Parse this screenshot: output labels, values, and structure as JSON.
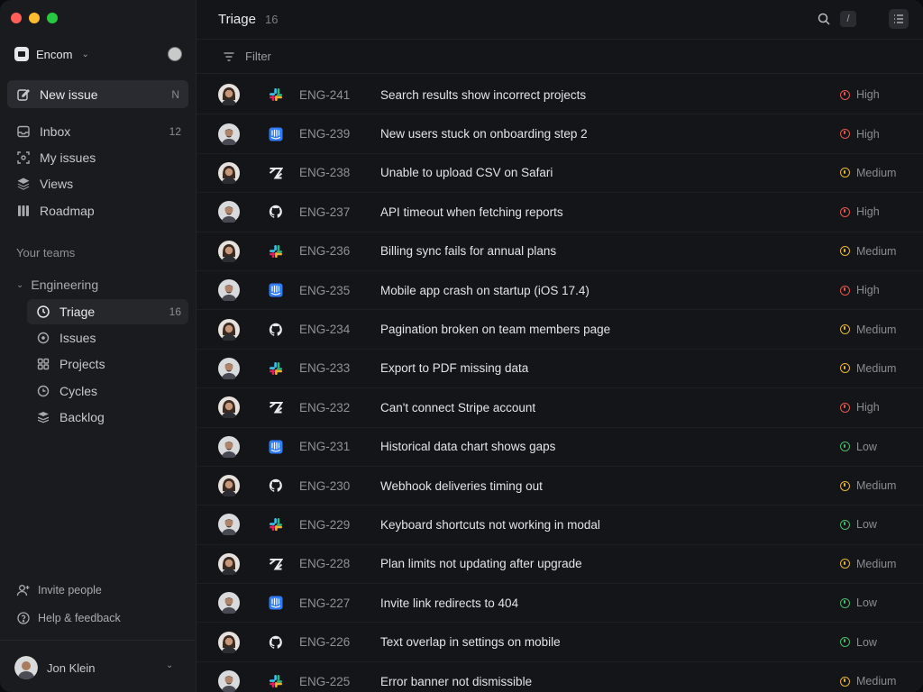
{
  "colors": {
    "red": "#ff5f57",
    "yellow": "#febc2e",
    "green": "#28c840",
    "high": "#e5574f",
    "medium": "#e4b43a",
    "low": "#4bb86a",
    "jira_blue": "#2f7cf6"
  },
  "workspace": {
    "name": "Encom"
  },
  "sidebar": {
    "new_issue": {
      "label": "New issue",
      "shortcut": "N"
    },
    "nav": [
      {
        "label": "Inbox",
        "icon": "inbox-icon",
        "count": "12"
      },
      {
        "label": "My issues",
        "icon": "target-icon",
        "count": ""
      },
      {
        "label": "Views",
        "icon": "layers-icon",
        "count": ""
      },
      {
        "label": "Roadmap",
        "icon": "roadmap-icon",
        "count": ""
      }
    ],
    "section": "Your teams",
    "team": {
      "name": "Engineering"
    },
    "team_items": [
      {
        "label": "Triage",
        "icon": "triage-icon",
        "count": "16"
      },
      {
        "label": "Issues",
        "icon": "circle-icon",
        "count": ""
      },
      {
        "label": "Projects",
        "icon": "grid-icon",
        "count": ""
      },
      {
        "label": "Cycles",
        "icon": "cycle-icon",
        "count": ""
      },
      {
        "label": "Backlog",
        "icon": "stack-icon",
        "count": ""
      }
    ],
    "invite": "Invite people",
    "help": "Help & feedback",
    "user": "Jon Klein"
  },
  "header": {
    "title": "Triage",
    "count": "16",
    "search_shortcut": "/"
  },
  "filter": {
    "label": "Filter"
  },
  "issues": [
    {
      "id": "ENG-241",
      "title": "Search results show incorrect projects",
      "source": "slack",
      "priority": "High",
      "avatar": "f"
    },
    {
      "id": "ENG-239",
      "title": "New users stuck on onboarding step 2",
      "source": "intercom",
      "priority": "High",
      "avatar": "m"
    },
    {
      "id": "ENG-238",
      "title": "Unable to upload CSV on Safari",
      "source": "zendesk",
      "priority": "Medium",
      "avatar": "f"
    },
    {
      "id": "ENG-237",
      "title": "API timeout when fetching reports",
      "source": "github",
      "priority": "High",
      "avatar": "m"
    },
    {
      "id": "ENG-236",
      "title": "Billing sync fails for annual plans",
      "source": "slack",
      "priority": "Medium",
      "avatar": "f"
    },
    {
      "id": "ENG-235",
      "title": "Mobile app crash on startup (iOS 17.4)",
      "source": "intercom",
      "priority": "High",
      "avatar": "m"
    },
    {
      "id": "ENG-234",
      "title": "Pagination broken on team members page",
      "source": "github",
      "priority": "Medium",
      "avatar": "f"
    },
    {
      "id": "ENG-233",
      "title": "Export to PDF missing data",
      "source": "slack",
      "priority": "Medium",
      "avatar": "m"
    },
    {
      "id": "ENG-232",
      "title": "Can't connect Stripe account",
      "source": "zendesk",
      "priority": "High",
      "avatar": "f"
    },
    {
      "id": "ENG-231",
      "title": "Historical data chart shows gaps",
      "source": "intercom",
      "priority": "Low",
      "avatar": "m"
    },
    {
      "id": "ENG-230",
      "title": "Webhook deliveries timing out",
      "source": "github",
      "priority": "Medium",
      "avatar": "f"
    },
    {
      "id": "ENG-229",
      "title": "Keyboard shortcuts not working in modal",
      "source": "slack",
      "priority": "Low",
      "avatar": "m"
    },
    {
      "id": "ENG-228",
      "title": "Plan limits not updating after upgrade",
      "source": "zendesk",
      "priority": "Medium",
      "avatar": "f"
    },
    {
      "id": "ENG-227",
      "title": "Invite link redirects to 404",
      "source": "intercom",
      "priority": "Low",
      "avatar": "m"
    },
    {
      "id": "ENG-226",
      "title": "Text overlap in settings on mobile",
      "source": "github",
      "priority": "Low",
      "avatar": "f"
    },
    {
      "id": "ENG-225",
      "title": "Error banner not dismissible",
      "source": "slack",
      "priority": "Medium",
      "avatar": "m"
    }
  ]
}
